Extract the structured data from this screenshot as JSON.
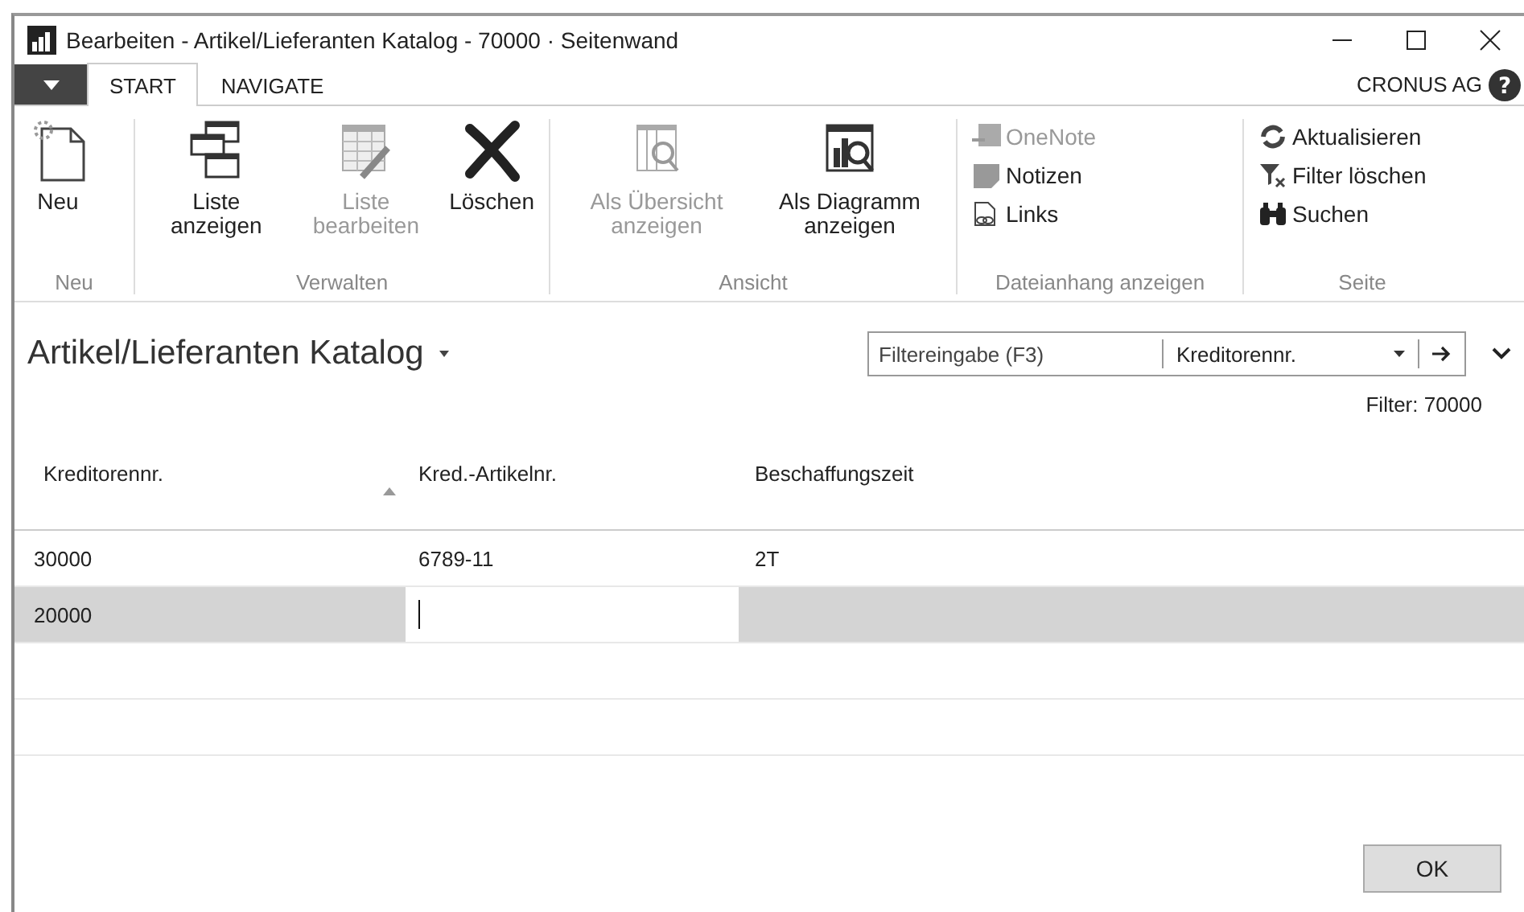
{
  "window": {
    "title": "Bearbeiten - Artikel/Lieferanten Katalog - 70000 · Seitenwand"
  },
  "tabs": [
    {
      "label": "START",
      "selected": true
    },
    {
      "label": "NAVIGATE",
      "selected": false
    }
  ],
  "company": "CRONUS AG",
  "help": "?",
  "ribbon": [
    {
      "label": "Neu",
      "actions": [
        {
          "label": "Neu",
          "kind": "large",
          "disabled": false
        }
      ]
    },
    {
      "label": "Verwalten",
      "actions": [
        {
          "label": "Liste anzeigen",
          "kind": "large",
          "disabled": false
        },
        {
          "label": "Liste bearbeiten",
          "kind": "large",
          "disabled": true
        },
        {
          "label": "Löschen",
          "kind": "large",
          "disabled": false
        }
      ]
    },
    {
      "label": "Ansicht",
      "actions": [
        {
          "label": "Als Übersicht anzeigen",
          "kind": "large",
          "disabled": true
        },
        {
          "label": "Als Diagramm anzeigen",
          "kind": "large",
          "disabled": false
        }
      ]
    },
    {
      "label": "Dateianhang anzeigen",
      "actions": [
        {
          "label": "OneNote",
          "kind": "small",
          "disabled": true
        },
        {
          "label": "Notizen",
          "kind": "small",
          "disabled": false
        },
        {
          "label": "Links",
          "kind": "small",
          "disabled": false
        }
      ]
    },
    {
      "label": "Seite",
      "actions": [
        {
          "label": "Aktualisieren",
          "kind": "small",
          "disabled": false
        },
        {
          "label": "Filter löschen",
          "kind": "small",
          "disabled": false
        },
        {
          "label": "Suchen",
          "kind": "small",
          "disabled": false
        }
      ]
    }
  ],
  "page": {
    "title": "Artikel/Lieferanten Katalog",
    "filter": {
      "placeholder": "Filtereingabe (F3)",
      "field": "Kreditorennr."
    },
    "filter_text": "Filter: 70000"
  },
  "table": {
    "columns": [
      {
        "label": "Kreditorennr.",
        "sorted": true
      },
      {
        "label": "Kred.-Artikelnr.",
        "sorted": false
      },
      {
        "label": "Beschaffungszeit",
        "sorted": false
      }
    ],
    "rows": [
      {
        "selected": false,
        "cells": [
          {
            "text": "30000"
          },
          {
            "text": "6789-11"
          },
          {
            "text": "2T"
          }
        ]
      },
      {
        "selected": true,
        "cells": [
          {
            "text": "20000"
          },
          {
            "editing": true
          },
          {}
        ]
      }
    ]
  },
  "buttons": [
    "OK"
  ]
}
